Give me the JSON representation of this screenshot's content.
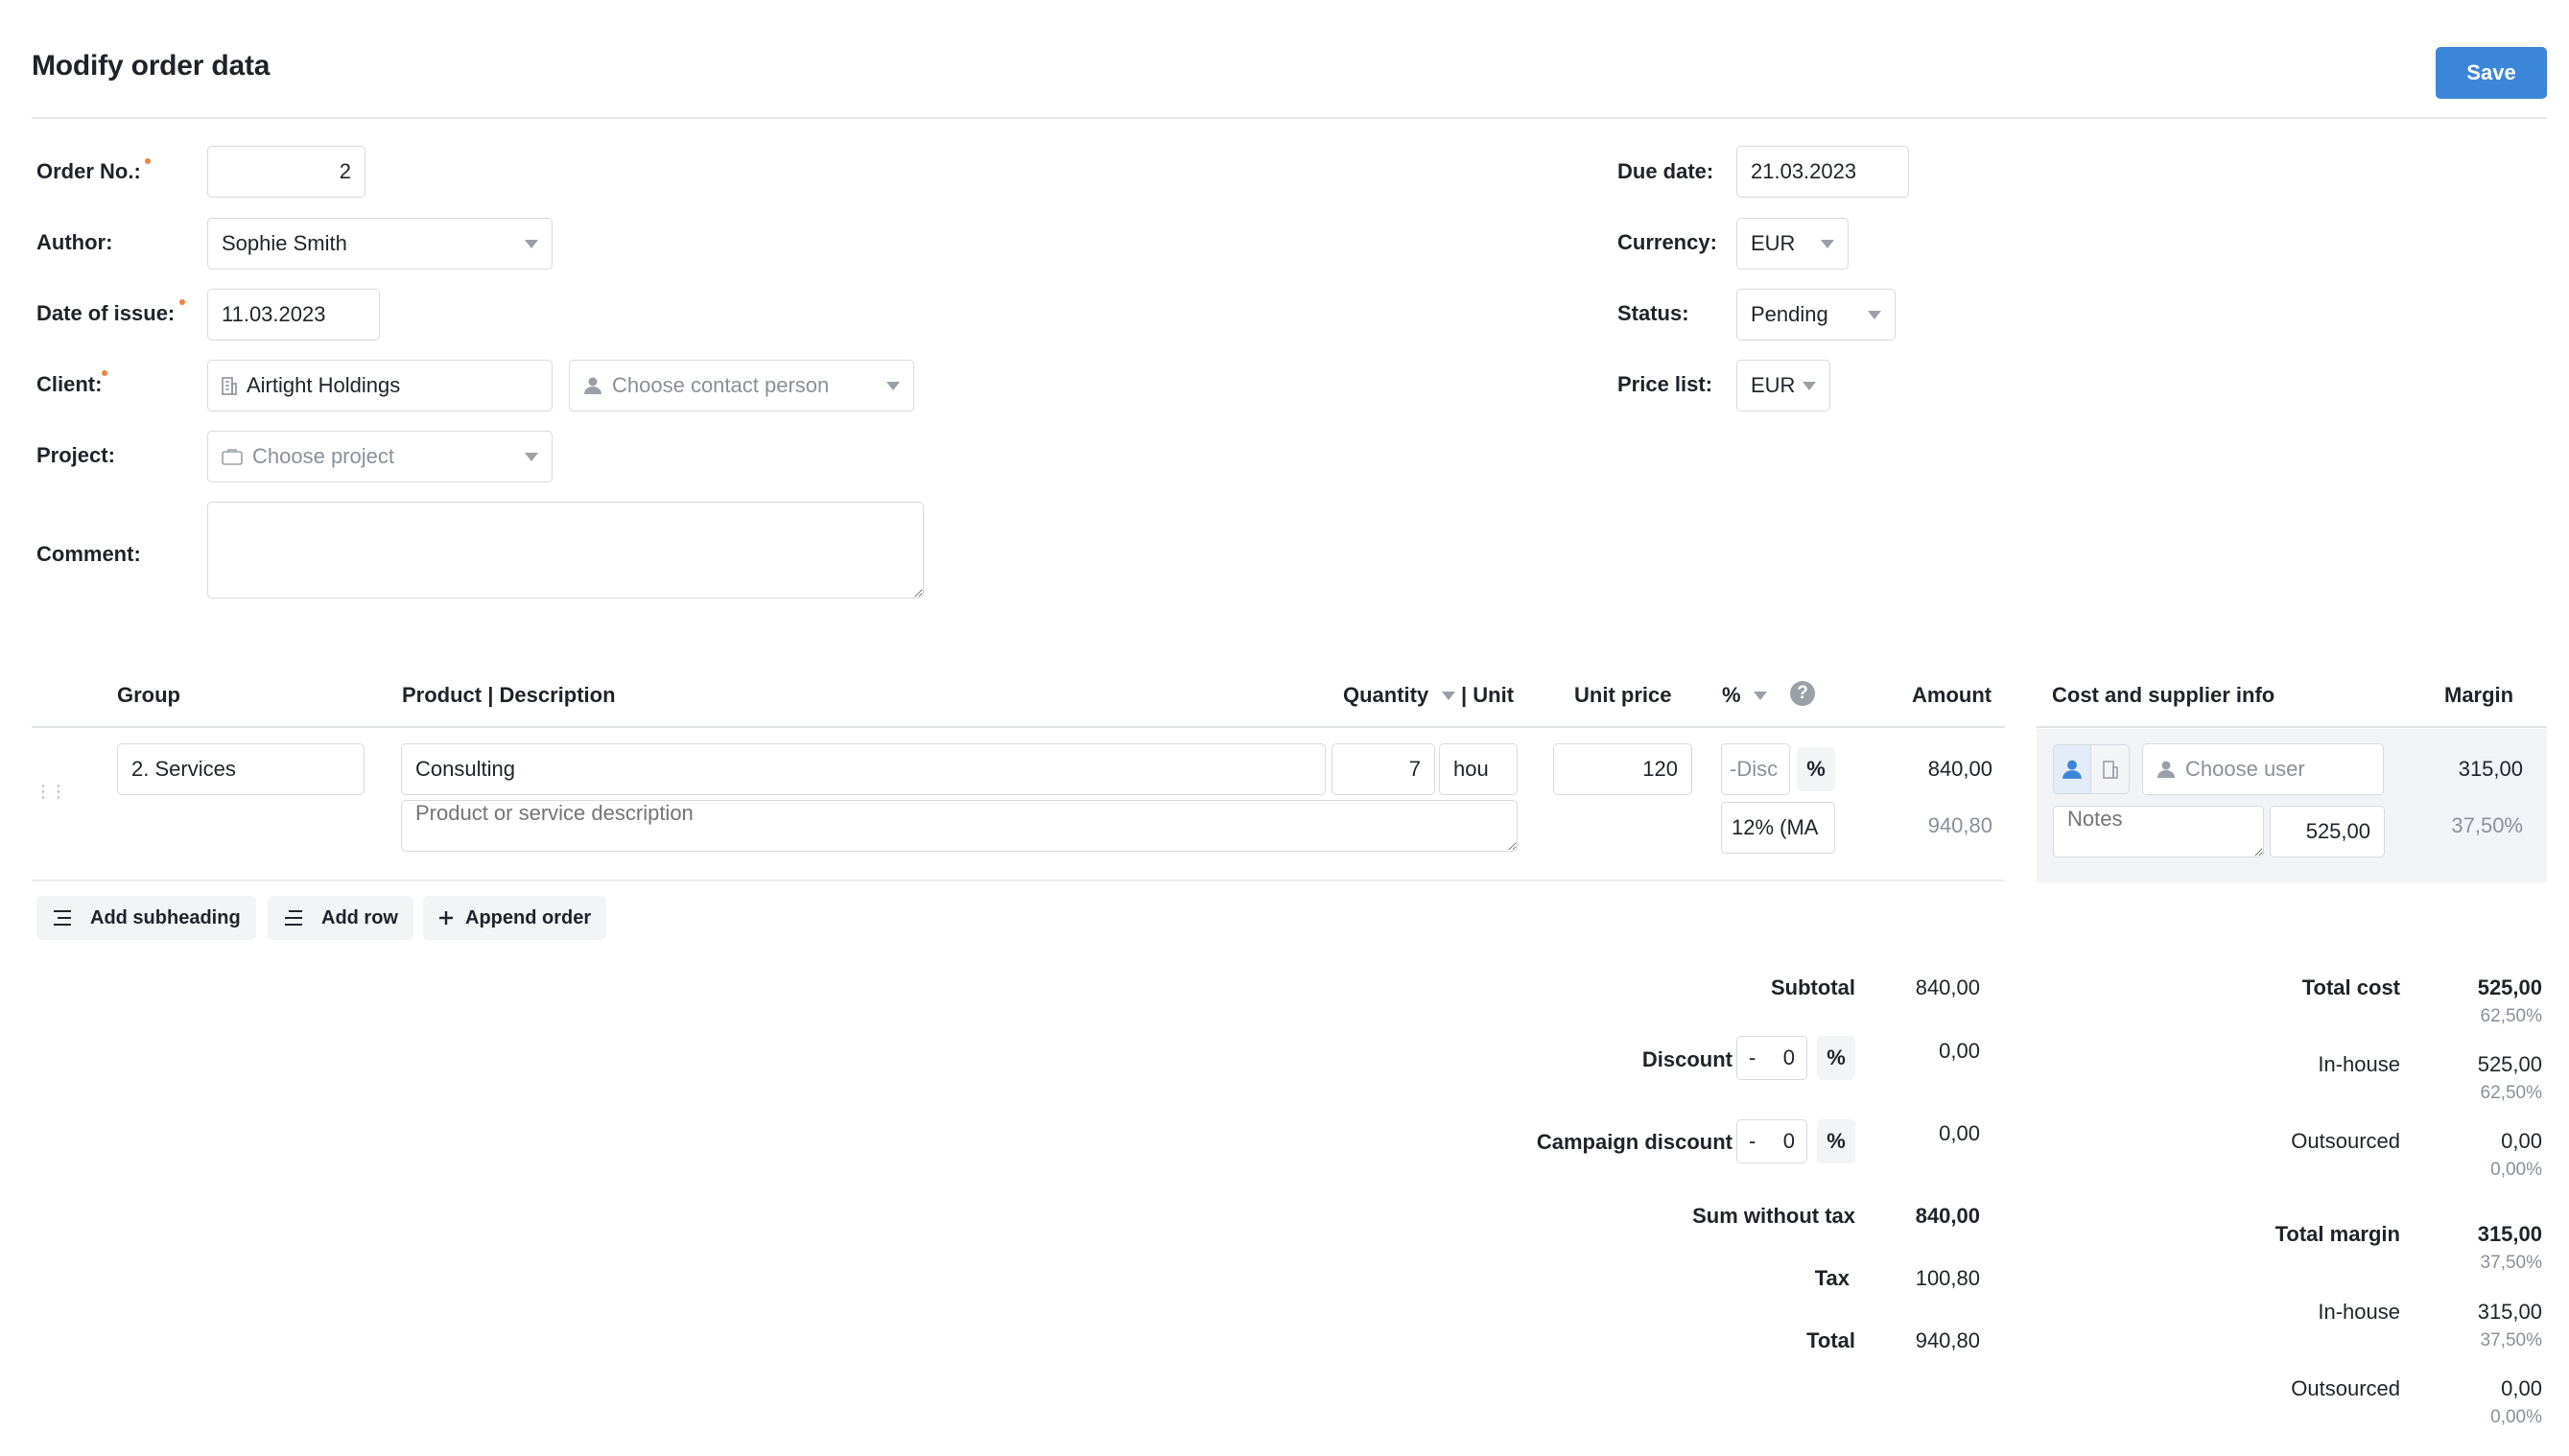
{
  "page": {
    "title": "Modify order data",
    "save_label": "Save"
  },
  "form_left": {
    "order_no_label": "Order No.:",
    "order_no_value": "2",
    "author_label": "Author:",
    "author_value": "Sophie Smith",
    "date_issue_label": "Date of issue:",
    "date_issue_value": "11.03.2023",
    "client_label": "Client:",
    "client_value": "Airtight Holdings",
    "contact_placeholder": "Choose contact person",
    "project_label": "Project:",
    "project_placeholder": "Choose project",
    "comment_label": "Comment:",
    "comment_value": ""
  },
  "form_right": {
    "due_date_label": "Due date:",
    "due_date_value": "21.03.2023",
    "currency_label": "Currency:",
    "currency_value": "EUR",
    "status_label": "Status:",
    "status_value": "Pending",
    "price_list_label": "Price list:",
    "price_list_value": "EUR"
  },
  "table": {
    "headers": {
      "group": "Group",
      "product": "Product | Description",
      "quantity": "Quantity",
      "unit": "| Unit",
      "unit_price": "Unit price",
      "percent": "%",
      "amount": "Amount",
      "cost_supplier": "Cost and supplier info",
      "margin": "Margin"
    },
    "row": {
      "group": "2. Services",
      "product": "Consulting",
      "quantity": "7",
      "unit": "hou",
      "unit_price": "120",
      "discount_placeholder": "-Disc",
      "percent_sign": "%",
      "amount": "840,00",
      "description_placeholder": "Product or service description",
      "tax": "12% (MA",
      "amount_with_tax": "940,80",
      "user_placeholder": "Choose user",
      "notes_placeholder": "Notes",
      "cost": "525,00",
      "margin": "315,00",
      "margin_pct": "37,50%"
    }
  },
  "actions": {
    "add_subheading": "Add subheading",
    "add_row": "Add row",
    "append_order": "Append order"
  },
  "totals": {
    "subtotal_label": "Subtotal",
    "subtotal_value": "840,00",
    "discount_label": "Discount",
    "discount_sign": "-",
    "discount_input": "0",
    "discount_pct": "%",
    "discount_value": "0,00",
    "campaign_label": "Campaign discount",
    "campaign_sign": "-",
    "campaign_input": "0",
    "campaign_pct": "%",
    "campaign_value": "0,00",
    "sum_no_tax_label": "Sum without tax",
    "sum_no_tax_value": "840,00",
    "tax_label": "Tax",
    "tax_value": "100,80",
    "total_label": "Total",
    "total_value": "940,80"
  },
  "cost_totals": {
    "total_cost_label": "Total cost",
    "total_cost_value": "525,00",
    "total_cost_pct": "62,50%",
    "inhouse1_label": "In-house",
    "inhouse1_value": "525,00",
    "inhouse1_pct": "62,50%",
    "outsourced1_label": "Outsourced",
    "outsourced1_value": "0,00",
    "outsourced1_pct": "0,00%",
    "total_margin_label": "Total margin",
    "total_margin_value": "315,00",
    "total_margin_pct": "37,50%",
    "inhouse2_label": "In-house",
    "inhouse2_value": "315,00",
    "inhouse2_pct": "37,50%",
    "outsourced2_label": "Outsourced",
    "outsourced2_value": "0,00",
    "outsourced2_pct": "0,00%"
  },
  "colors": {
    "accent": "#3c86d9",
    "required": "#f0843c",
    "panel": "#f1f3f6"
  }
}
